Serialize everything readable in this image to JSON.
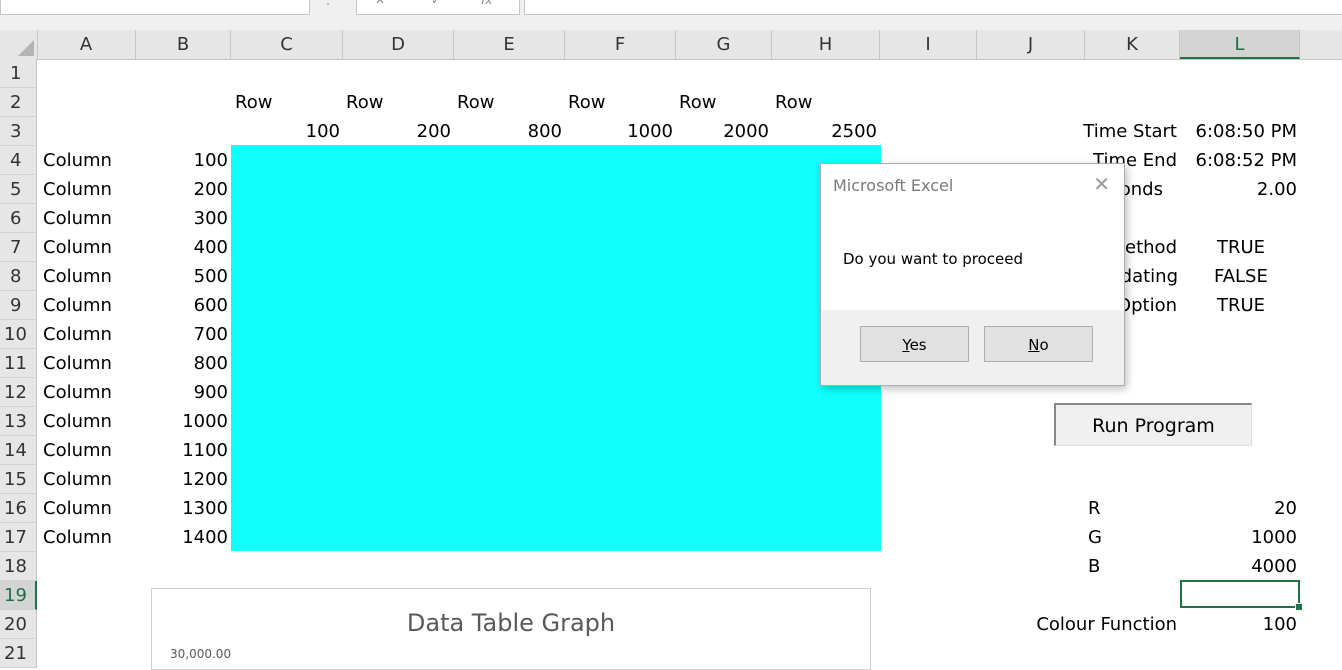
{
  "toolbar": {
    "fx_symbol": "fx",
    "cancel_symbol": "✕",
    "enter_symbol": "✓",
    "dots": ":"
  },
  "columns": [
    "A",
    "B",
    "C",
    "D",
    "E",
    "F",
    "G",
    "H",
    "I",
    "J",
    "K",
    "L"
  ],
  "rows": [
    "1",
    "2",
    "3",
    "4",
    "5",
    "6",
    "7",
    "8",
    "9",
    "10",
    "11",
    "12",
    "13",
    "14",
    "15",
    "16",
    "17",
    "18",
    "19",
    "20",
    "21"
  ],
  "selected_column": "L",
  "selected_row": "19",
  "header_row2": [
    "Row",
    "Row",
    "Row",
    "Row",
    "Row",
    "Row"
  ],
  "header_row3": [
    "100",
    "200",
    "800",
    "1000",
    "2000",
    "2500"
  ],
  "table_rows": [
    {
      "label": "Column",
      "value": "100"
    },
    {
      "label": "Column",
      "value": "200"
    },
    {
      "label": "Column",
      "value": "300"
    },
    {
      "label": "Column",
      "value": "400"
    },
    {
      "label": "Column",
      "value": "500"
    },
    {
      "label": "Column",
      "value": "600"
    },
    {
      "label": "Column",
      "value": "700"
    },
    {
      "label": "Column",
      "value": "800"
    },
    {
      "label": "Column",
      "value": "900"
    },
    {
      "label": "Column",
      "value": "1000"
    },
    {
      "label": "Column",
      "value": "1100"
    },
    {
      "label": "Column",
      "value": "1200"
    },
    {
      "label": "Column",
      "value": "1300"
    },
    {
      "label": "Column",
      "value": "1400"
    }
  ],
  "fill_color": "#10FFFF",
  "side": {
    "time_start_label": "Time Start",
    "time_start_value": "6:08:50 PM",
    "time_end_label": "Time End",
    "time_end_value": "6:08:52 PM",
    "seconds_label": "onds",
    "seconds_value": "2.00",
    "method_label": "ethod",
    "method_value": "TRUE",
    "updating_label": "dating",
    "updating_value": "FALSE",
    "option_label": "Option",
    "option_value": "TRUE",
    "run_button": "Run Program",
    "r_label": "R",
    "r_value": "20",
    "g_label": "G",
    "g_value": "1000",
    "b_label": "B",
    "b_value": "4000",
    "colour_label": "Colour Function",
    "colour_value": "100"
  },
  "chart": {
    "title": "Data Table Graph",
    "first_tick": "30,000.00"
  },
  "dialog": {
    "title": "Microsoft Excel",
    "message": "Do you want to proceed",
    "yes_label": "Yes",
    "no_label": "No"
  }
}
